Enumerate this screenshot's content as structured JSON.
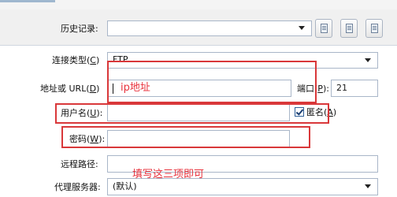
{
  "history": {
    "label": "历史记录:",
    "value": ""
  },
  "toolbar": {
    "icons": [
      "document-icon",
      "save-icon",
      "delete-icon"
    ]
  },
  "connection": {
    "label_main": "连接类型(",
    "label_key": "C",
    "label_end": ")",
    "value": "FTP"
  },
  "address": {
    "label_main": "地址或 URL(",
    "label_key": "D",
    "label_end": ")",
    "annotation": "ip地址"
  },
  "port": {
    "label_main": "端口(",
    "label_key": "P",
    "label_end": "):",
    "value": "21"
  },
  "username": {
    "label_main": "用户名(",
    "label_key": "U",
    "label_end": "):",
    "value": ""
  },
  "anonymous": {
    "label_main": "匿名(",
    "label_key": "A",
    "label_end": ")",
    "checked": true
  },
  "password": {
    "label_main": "密码(",
    "label_key": "W",
    "label_end": "):",
    "value": ""
  },
  "remote_path": {
    "label": "远程路径:",
    "value": ""
  },
  "note": "填写这三项即可",
  "proxy": {
    "label": "代理服务器:",
    "value": "(默认)"
  },
  "colors": {
    "annotation": "#e8323c",
    "field_border": "#a9b6c8"
  }
}
